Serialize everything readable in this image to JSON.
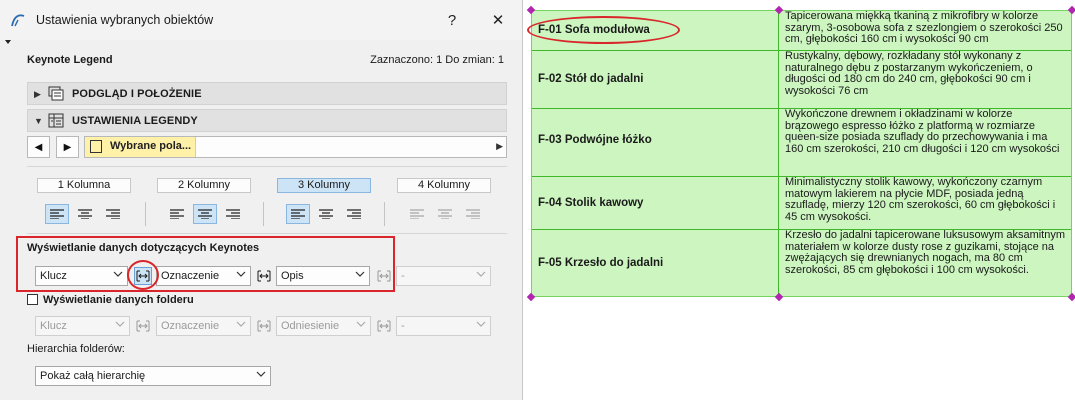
{
  "dialog": {
    "title": "Ustawienia wybranych obiektów",
    "help_label": "?",
    "close_label": "✕",
    "element_type": "Keynote Legend",
    "selection_info": "Zaznaczono: 1 Do zmian: 1"
  },
  "sections": [
    {
      "label": "PODGLĄD I POŁOŻENIE",
      "expanded": false
    },
    {
      "label": "USTAWIENIA LEGENDY",
      "expanded": true
    }
  ],
  "favorites": {
    "prev_label": "◀",
    "next_label": "▶",
    "value": "Wybrane pola..."
  },
  "columns": {
    "options": [
      "1 Kolumna",
      "2 Kolumny",
      "3 Kolumny",
      "4 Kolumny"
    ],
    "selected": "3 Kolumny"
  },
  "keynote_group": {
    "title": "Wyświetlanie danych dotyczących Keynotes",
    "fields": [
      "Klucz",
      "Oznaczenie",
      "Opis",
      "-"
    ]
  },
  "folder_group": {
    "checkbox_label": "Wyświetlanie danych folderu",
    "checked": false,
    "fields": [
      "Klucz",
      "Oznaczenie",
      "Odniesienie",
      "-"
    ]
  },
  "hierarchy": {
    "label": "Hierarchia folderów:",
    "value": "Pokaż całą hierarchię"
  },
  "legend_table": {
    "background": "#ccf5c0",
    "line_color": "#3fb92a",
    "rows": [
      {
        "key": "F-01 Sofa modułowa",
        "description": "Tapicerowana miękką tkaniną z mikrofibry w kolorze szarym, 3-osobowa sofa z szezlongiem o szerokości 250 cm, głębokości 160 cm i wysokości 90 cm"
      },
      {
        "key": "F-02 Stół do jadalni",
        "description": "Rustykalny, dębowy, rozkładany stół wykonany z naturalnego dębu z postarzanym wykończeniem, o długości od 180 cm do 240 cm, głębokości 90 cm i wysokości 76 cm"
      },
      {
        "key": "F-03 Podwójne łóżko",
        "description": "Wykończone drewnem i okładzinami w kolorze brązowego espresso łóżko z platformą w rozmiarze queen-size posiada szuflady do przechowywania i ma 160 cm szerokości, 210 cm długości i 120 cm wysokości"
      },
      {
        "key": "F-04 Stolik kawowy",
        "description": "Minimalistyczny stolik kawowy, wykończony czarnym matowym lakierem na płycie MDF, posiada jedną szufladę, mierzy 120 cm szerokości, 60 cm głębokości i 45 cm wysokości."
      },
      {
        "key": "F-05 Krzesło do jadalni",
        "description": "Krzesło do jadalni tapicerowane luksusowym aksamitnym materiałem w kolorze dusty rose z guzikami, stojące na zwężających się drewnianych nogach, ma 80 cm szerokości, 85 cm głębokości i 100 cm wysokości."
      }
    ]
  },
  "annotation_color": "#d9262a"
}
